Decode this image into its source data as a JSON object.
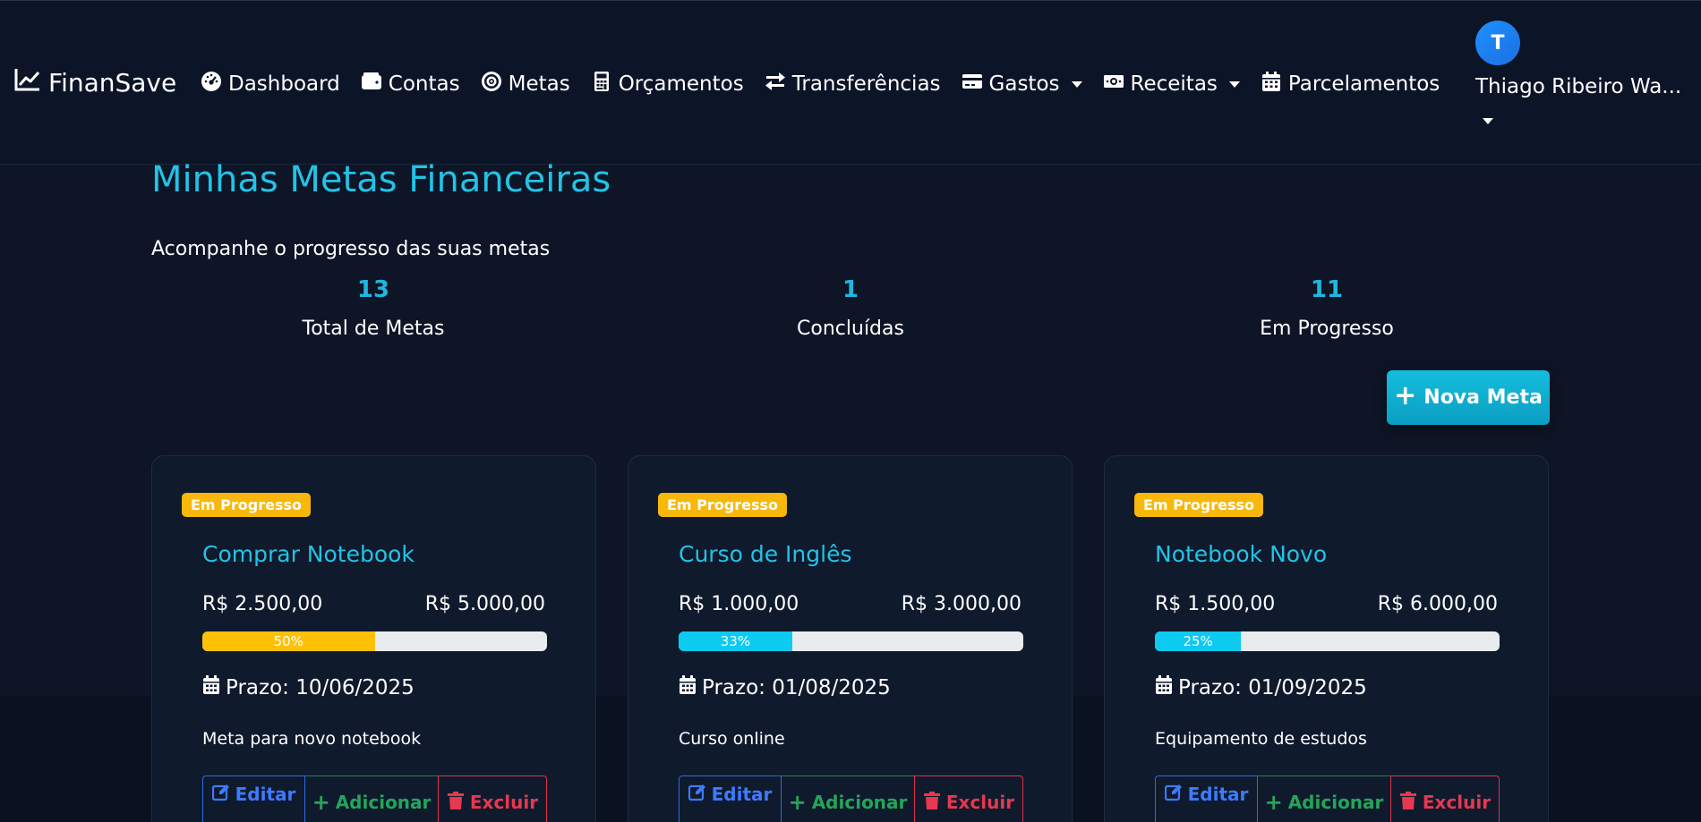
{
  "brand": {
    "name": "FinanSave",
    "icon": "chart-line-icon"
  },
  "nav": [
    {
      "label": "Dashboard",
      "icon": "gauge-icon",
      "dropdown": false
    },
    {
      "label": "Contas",
      "icon": "wallet-icon",
      "dropdown": false
    },
    {
      "label": "Metas",
      "icon": "target-icon",
      "dropdown": false
    },
    {
      "label": "Orçamentos",
      "icon": "calculator-icon",
      "dropdown": false
    },
    {
      "label": "Transferências",
      "icon": "exchange-icon",
      "dropdown": false
    },
    {
      "label": "Gastos",
      "icon": "credit-card-icon",
      "dropdown": true
    },
    {
      "label": "Receitas",
      "icon": "money-bill-icon",
      "dropdown": true
    },
    {
      "label": "Parcelamentos",
      "icon": "calendar-icon",
      "dropdown": false
    }
  ],
  "user": {
    "initial": "T",
    "name": "Thiago Ribeiro Wa..."
  },
  "page": {
    "title": "Minhas Metas Financeiras",
    "subtitle": "Acompanhe o progresso das suas metas",
    "new_button": "Nova Meta"
  },
  "stats": [
    {
      "value": "13",
      "label": "Total de Metas"
    },
    {
      "value": "1",
      "label": "Concluídas"
    },
    {
      "value": "11",
      "label": "Em Progresso"
    }
  ],
  "goals": [
    {
      "status": "Em Progresso",
      "name": "Comprar Notebook",
      "current": "R$ 2.500,00",
      "target": "R$ 5.000,00",
      "progress_pct": 50,
      "progress_label": "50%",
      "progress_color": "#ffc107",
      "deadline": "Prazo: 10/06/2025",
      "description": "Meta para novo notebook"
    },
    {
      "status": "Em Progresso",
      "name": "Curso de Inglês",
      "current": "R$ 1.000,00",
      "target": "R$ 3.000,00",
      "progress_pct": 33,
      "progress_label": "33%",
      "progress_color": "#0dcaf0",
      "deadline": "Prazo: 01/08/2025",
      "description": "Curso online"
    },
    {
      "status": "Em Progresso",
      "name": "Notebook Novo",
      "current": "R$ 1.500,00",
      "target": "R$ 6.000,00",
      "progress_pct": 25,
      "progress_label": "25%",
      "progress_color": "#0dcaf0",
      "deadline": "Prazo: 01/09/2025",
      "description": "Equipamento de estudos"
    }
  ],
  "actions": {
    "edit": "Editar",
    "add": "Adicionar",
    "delete": "Excluir"
  },
  "colors": {
    "accent": "#22c3e6",
    "badge": "#f7b80b",
    "edit": "#3d7bff",
    "add": "#23a55a",
    "delete": "#e6384f"
  }
}
